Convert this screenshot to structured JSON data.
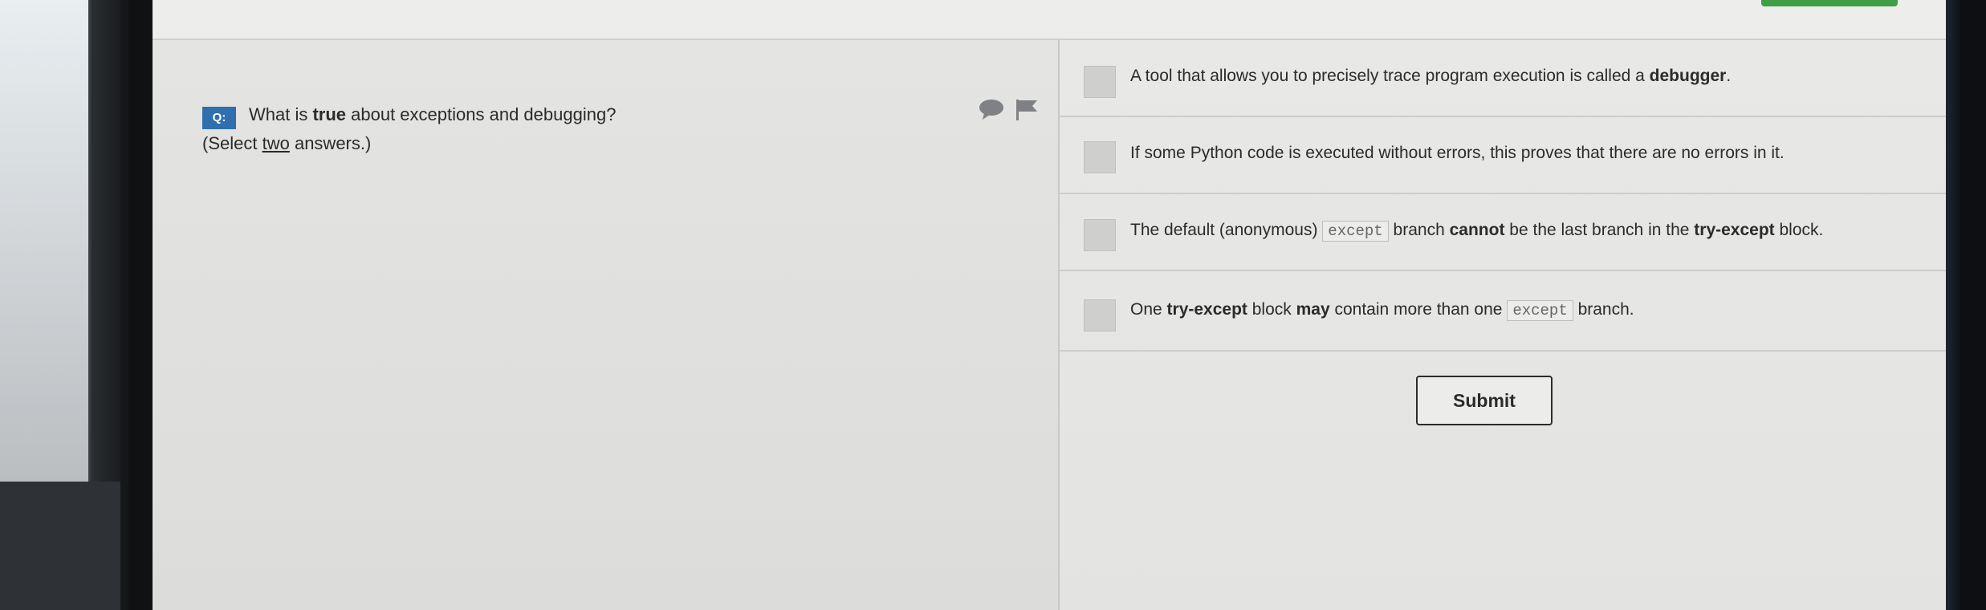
{
  "question": {
    "badge": "Q:",
    "text_before": "What is ",
    "text_bold": "true",
    "text_after": " about exceptions and debugging?",
    "instruction_before": "(Select ",
    "instruction_underlined": "two",
    "instruction_after": " answers.)"
  },
  "options": [
    {
      "parts": [
        {
          "t": "A tool that allows you to precisely trace program execution is called a ",
          "s": "normal"
        },
        {
          "t": "debugger",
          "s": "bold"
        },
        {
          "t": ".",
          "s": "normal"
        }
      ]
    },
    {
      "parts": [
        {
          "t": "If some Python code is executed without errors, this proves that there are no errors in it.",
          "s": "normal"
        }
      ]
    },
    {
      "parts": [
        {
          "t": "The default (anonymous) ",
          "s": "normal"
        },
        {
          "t": "except",
          "s": "code"
        },
        {
          "t": " branch ",
          "s": "normal"
        },
        {
          "t": "cannot",
          "s": "bold"
        },
        {
          "t": " be the last branch in the ",
          "s": "normal"
        },
        {
          "t": "try-except",
          "s": "bold"
        },
        {
          "t": " block.",
          "s": "normal"
        }
      ]
    },
    {
      "parts": [
        {
          "t": "One ",
          "s": "normal"
        },
        {
          "t": "try-except",
          "s": "bold"
        },
        {
          "t": " block ",
          "s": "normal"
        },
        {
          "t": "may",
          "s": "bold"
        },
        {
          "t": " contain more than one ",
          "s": "normal"
        },
        {
          "t": "except",
          "s": "code"
        },
        {
          "t": " branch.",
          "s": "normal"
        }
      ]
    }
  ],
  "submit_label": "Submit",
  "icons": {
    "comment": "comment-icon",
    "flag": "flag-icon"
  },
  "colors": {
    "badge": "#2f6fae",
    "accent_green": "#3f9e46"
  }
}
